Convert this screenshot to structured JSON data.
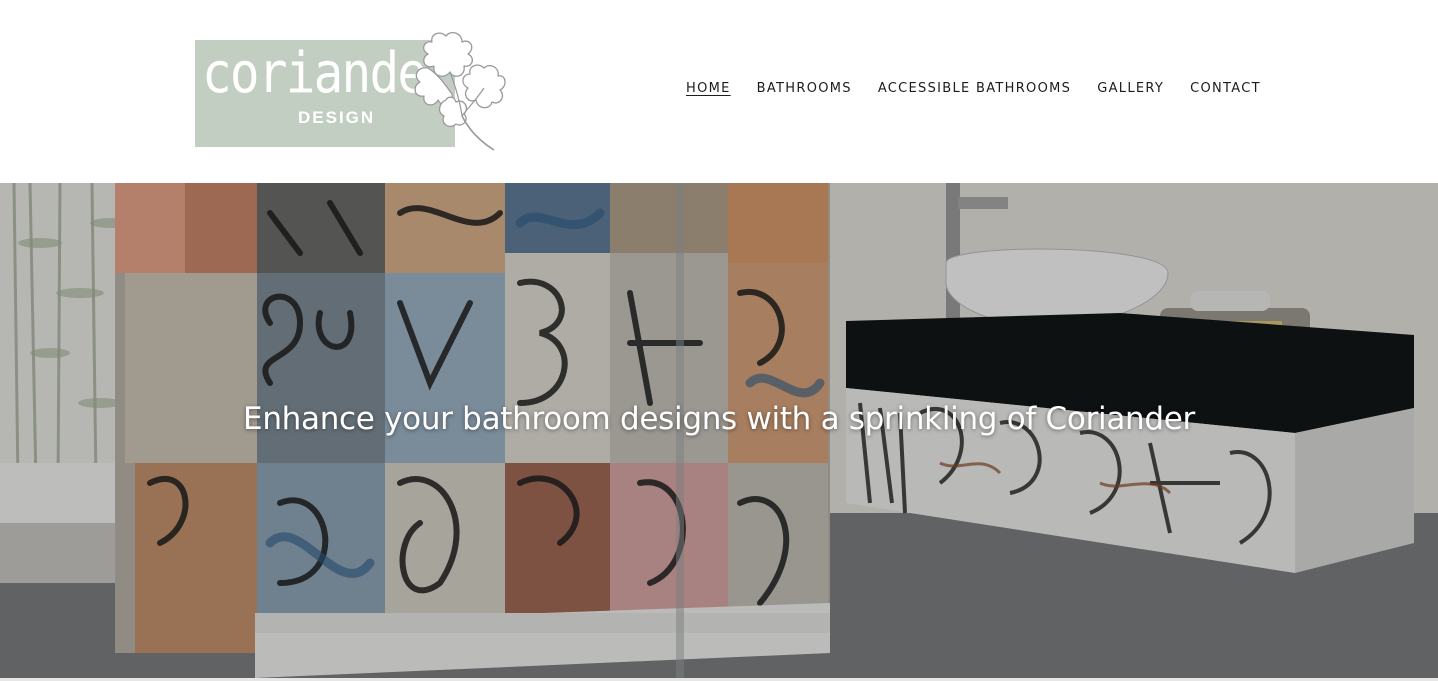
{
  "logo": {
    "wordmark": "coriander",
    "subtitle": "DESIGN",
    "box_color": "#c3cec2",
    "icon": "coriander-leaf-icon"
  },
  "nav": {
    "items": [
      {
        "label": "HOME",
        "active": true
      },
      {
        "label": "BATHROOMS",
        "active": false
      },
      {
        "label": "ACCESSIBLE BATHROOMS",
        "active": false
      },
      {
        "label": "GALLERY",
        "active": false
      },
      {
        "label": "CONTACT",
        "active": false
      }
    ]
  },
  "hero": {
    "title": "Enhance your bathroom designs with a sprinkling of Coriander",
    "image": "graffiti-tiled-bathroom-photo"
  }
}
